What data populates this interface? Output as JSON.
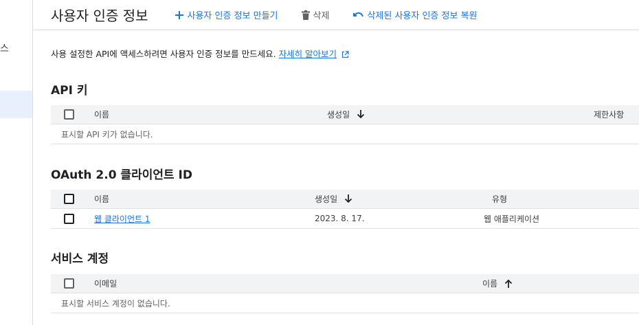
{
  "rail": {
    "glyph": "스"
  },
  "header": {
    "title": "사용자 인증 정보",
    "create_label": "사용자 인증 정보 만들기",
    "delete_label": "삭제",
    "restore_label": "삭제된 사용자 인증 정보 복원"
  },
  "description": {
    "text": "사용 설정한 API에 액세스하려면 사용자 인증 정보를 만드세요.",
    "link": "자세히 알아보기"
  },
  "api_keys": {
    "title": "API 키",
    "columns": {
      "name": "이름",
      "created": "생성일",
      "restrictions": "제한사항"
    },
    "empty": "표시할 API 키가 없습니다."
  },
  "oauth": {
    "title": "OAuth 2.0 클라이언트 ID",
    "columns": {
      "name": "이름",
      "created": "생성일",
      "type": "유형"
    },
    "rows": [
      {
        "name": "웹 클라이언트 1",
        "created": "2023. 8. 17.",
        "type": "웹 애플리케이션"
      }
    ]
  },
  "service_accounts": {
    "title": "서비스 계정",
    "columns": {
      "email": "이메일",
      "name": "이름"
    },
    "empty": "표시할 서비스 계정이 없습니다."
  },
  "colors": {
    "accent": "#1a73e8",
    "header_bg": "#f1f3f4",
    "border": "#dadce0"
  }
}
